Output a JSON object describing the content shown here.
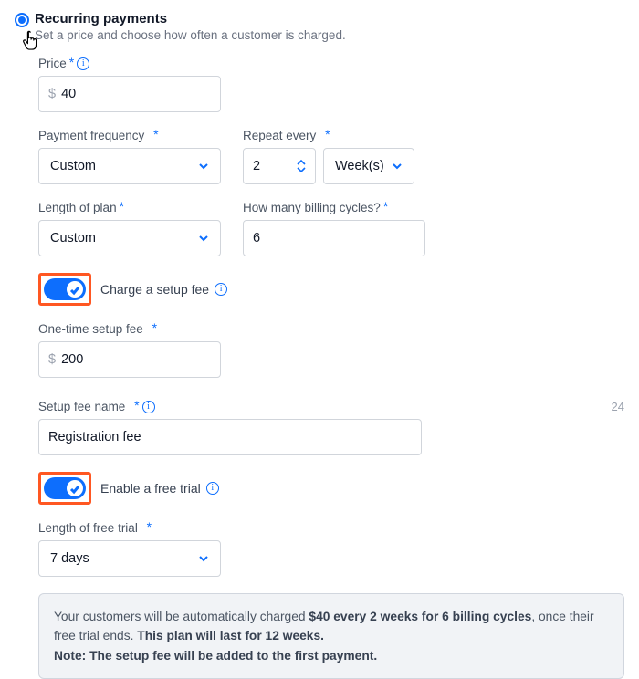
{
  "header": {
    "title": "Recurring payments",
    "subtitle": "Set a price and choose how often a customer is charged."
  },
  "price": {
    "label": "Price",
    "currency": "$",
    "value": "40"
  },
  "payment_frequency": {
    "label": "Payment frequency",
    "value": "Custom"
  },
  "repeat_every": {
    "label": "Repeat every",
    "count": "2",
    "unit": "Week(s)"
  },
  "length_of_plan": {
    "label": "Length of plan",
    "value": "Custom"
  },
  "billing_cycles": {
    "label": "How many billing cycles?",
    "value": "6"
  },
  "setup_toggle": {
    "label": "Charge a setup fee"
  },
  "setup_fee": {
    "label": "One-time setup fee",
    "currency": "$",
    "value": "200"
  },
  "setup_name": {
    "label": "Setup fee name",
    "value": "Registration fee",
    "counter": "24"
  },
  "trial_toggle": {
    "label": "Enable a free trial"
  },
  "trial_length": {
    "label": "Length of free trial",
    "value": "7 days"
  },
  "summary": {
    "prefix": "Your customers will be automatically charged ",
    "bold1": "$40 every 2 weeks for 6 billing cycles",
    "mid": ", once their free trial ends. ",
    "bold2": "This plan will last for 12 weeks.",
    "note_label": "Note: ",
    "note_text": "The setup fee will be added to the first payment."
  }
}
